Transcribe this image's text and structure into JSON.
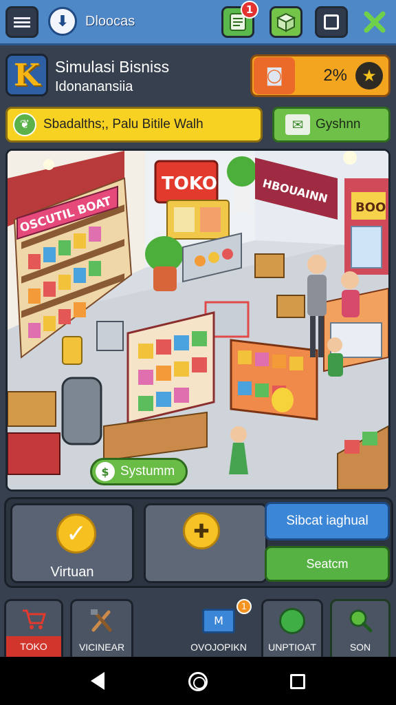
{
  "header": {
    "app_title": "Dloocas",
    "notification_count": "1",
    "icons": [
      "menu-icon",
      "download-icon",
      "list-icon",
      "cube-icon",
      "square-icon",
      "close-icon"
    ]
  },
  "title_row": {
    "logo_letter": "K",
    "title": "Simulasi Bisniss",
    "subtitle": "Idonanansiia",
    "percent": "2%",
    "icons": [
      "camera-icon",
      "star-icon"
    ]
  },
  "action_row": {
    "yellow_bar_text": "Sbadalths;, Palu Bitile Walh",
    "green_button_label": "Gyshnn"
  },
  "scene": {
    "signs": [
      "OSCUTIL BOAT",
      "TOKO",
      "HBOUAINN",
      "BOO"
    ],
    "system_button_label": "Systumm",
    "colors": {
      "floor": "#d8dde3",
      "shelf_red": "#e04a4a",
      "shelf_yellow": "#f3c64a",
      "counter_orange": "#f08a4b"
    }
  },
  "panel": {
    "card1_label": "Virtuan",
    "card2_label": "",
    "blue_button_label": "Sibcat iaghual",
    "green_button_label": "Seatcm"
  },
  "bottom_nav": [
    {
      "label": "TOKO",
      "icon": "cart-icon",
      "active": true
    },
    {
      "label": "VICINEAR",
      "icon": "tools-icon",
      "active": false
    },
    {
      "label": "OVOJOPIKN",
      "icon": "calendar-icon",
      "badge": "1",
      "active": false
    },
    {
      "label": "UNPTIOAT",
      "icon": "chat-icon",
      "active": false
    },
    {
      "label": "SON",
      "icon": "search-icon",
      "active": false
    }
  ],
  "calendar_icon_text": "M"
}
